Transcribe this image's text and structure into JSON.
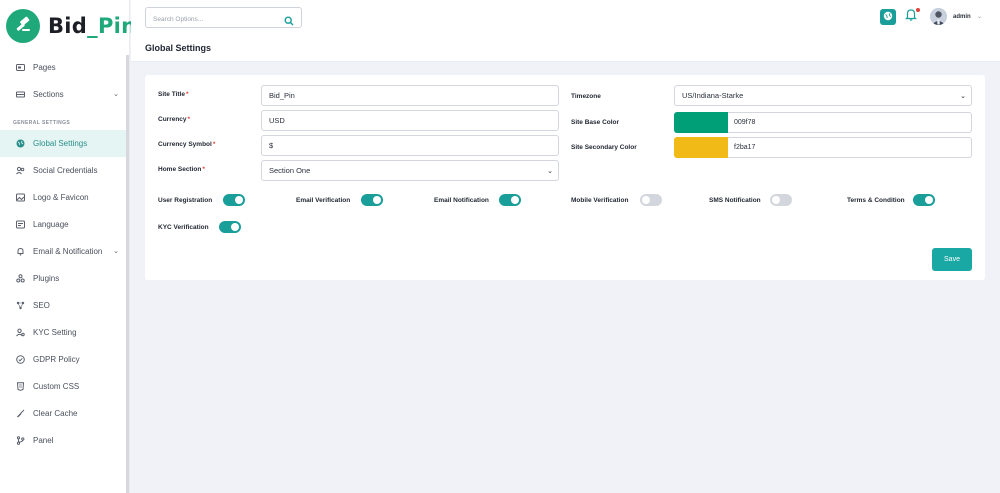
{
  "brand": {
    "name_part1": "Bid",
    "separator": "_",
    "name_part2": "Pin",
    "accent_color": "#1fa97a"
  },
  "sidebar": {
    "items_top": [
      {
        "label": "Pages",
        "icon": "pages-icon"
      },
      {
        "label": "Sections",
        "icon": "sections-icon",
        "has_submenu": true
      }
    ],
    "section_header": "GENERAL SETTINGS",
    "items": [
      {
        "label": "Global Settings",
        "icon": "globe-icon",
        "active": true
      },
      {
        "label": "Social Credentials",
        "icon": "users-icon"
      },
      {
        "label": "Logo & Favicon",
        "icon": "image-icon"
      },
      {
        "label": "Language",
        "icon": "language-icon"
      },
      {
        "label": "Email & Notification",
        "icon": "bell-icon",
        "has_submenu": true
      },
      {
        "label": "Plugins",
        "icon": "plugins-icon"
      },
      {
        "label": "SEO",
        "icon": "seo-icon"
      },
      {
        "label": "KYC Setting",
        "icon": "kyc-icon"
      },
      {
        "label": "GDPR Policy",
        "icon": "check-circle-icon"
      },
      {
        "label": "Custom CSS",
        "icon": "css-icon"
      },
      {
        "label": "Clear Cache",
        "icon": "broom-icon"
      },
      {
        "label": "Panel",
        "icon": "branch-icon"
      }
    ]
  },
  "header": {
    "search_placeholder": "Search Options...",
    "page_title": "Global Settings",
    "user_name": "admin"
  },
  "form": {
    "site_title_label": "Site Title",
    "site_title_value": "Bid_Pin",
    "currency_label": "Currency",
    "currency_value": "USD",
    "currency_symbol_label": "Currency Symbol",
    "currency_symbol_value": "$",
    "home_section_label": "Home Section",
    "home_section_value": "Section One",
    "timezone_label": "Timezone",
    "timezone_value": "US/Indiana-Starke",
    "base_color_label": "Site Base Color",
    "base_color_value": "009f78",
    "base_color_hex": "#009f78",
    "secondary_color_label": "Site Secondary Color",
    "secondary_color_value": "f2ba17",
    "secondary_color_hex": "#f2ba17",
    "toggles": [
      {
        "label": "User Registration",
        "on": true
      },
      {
        "label": "Email Verification",
        "on": true
      },
      {
        "label": "Email Notification",
        "on": true
      },
      {
        "label": "Mobile Verification",
        "on": false
      },
      {
        "label": "SMS Notification",
        "on": false
      },
      {
        "label": "Terms & Condition",
        "on": true
      },
      {
        "label": "KYC Verification",
        "on": true
      }
    ],
    "save_label": "Save"
  },
  "colors": {
    "primary": "#1a9e9a",
    "active_bg": "#e5f5f3",
    "notification_dot": "#e0433b"
  }
}
